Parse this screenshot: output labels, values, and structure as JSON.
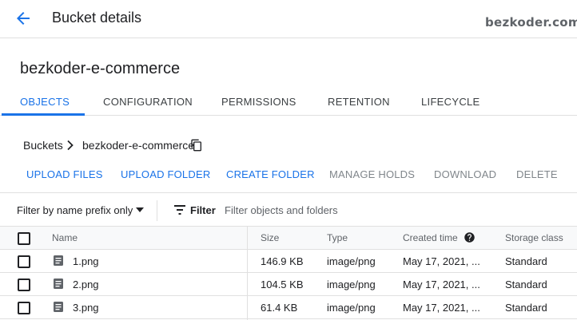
{
  "header": {
    "title": "Bucket details",
    "watermark": "bezkoder.com"
  },
  "bucket": {
    "name": "bezkoder-e-commerce"
  },
  "tabs": [
    {
      "label": "OBJECTS",
      "active": true
    },
    {
      "label": "CONFIGURATION",
      "active": false
    },
    {
      "label": "PERMISSIONS",
      "active": false
    },
    {
      "label": "RETENTION",
      "active": false
    },
    {
      "label": "LIFECYCLE",
      "active": false
    }
  ],
  "breadcrumb": {
    "root": "Buckets",
    "current": "bezkoder-e-commerce"
  },
  "actions": [
    {
      "label": "UPLOAD FILES",
      "enabled": true
    },
    {
      "label": "UPLOAD FOLDER",
      "enabled": true
    },
    {
      "label": "CREATE FOLDER",
      "enabled": true
    },
    {
      "label": "MANAGE HOLDS",
      "enabled": false
    },
    {
      "label": "DOWNLOAD",
      "enabled": false
    },
    {
      "label": "DELETE",
      "enabled": false
    }
  ],
  "filter": {
    "mode": "Filter by name prefix only",
    "label": "Filter",
    "placeholder": "Filter objects and folders"
  },
  "table": {
    "columns": [
      "Name",
      "Size",
      "Type",
      "Created time",
      "Storage class"
    ],
    "rows": [
      {
        "name": "1.png",
        "size": "146.9 KB",
        "type": "image/png",
        "created": "May 17, 2021, ...",
        "storage": "Standard"
      },
      {
        "name": "2.png",
        "size": "104.5 KB",
        "type": "image/png",
        "created": "May 17, 2021, ...",
        "storage": "Standard"
      },
      {
        "name": "3.png",
        "size": "61.4 KB",
        "type": "image/png",
        "created": "May 17, 2021, ...",
        "storage": "Standard"
      }
    ]
  },
  "colors": {
    "accent": "#1a73e8",
    "text": "#202124",
    "muted": "#5f6368",
    "disabled": "#80868b",
    "border": "#e0e0e0",
    "header_bg": "#f8f9fa"
  },
  "icons": [
    "arrow-back-icon",
    "chevron-right-icon",
    "copy-icon",
    "arrow-drop-down-icon",
    "filter-list-icon",
    "help-icon",
    "file-icon"
  ]
}
